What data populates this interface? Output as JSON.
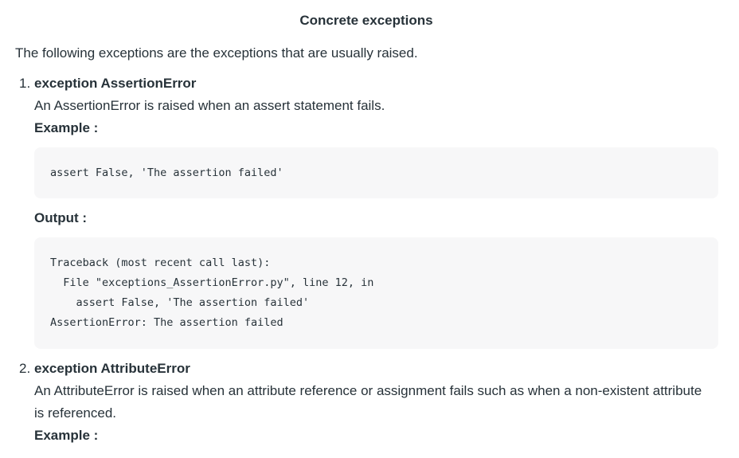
{
  "title": "Concrete exceptions",
  "intro": "The following exceptions are the exceptions that are usually raised.",
  "items": [
    {
      "number": "1.",
      "heading": "exception AssertionError",
      "description": "An AssertionError is raised when an assert statement fails.",
      "example_label": "Example :",
      "example_code": [
        "assert False, 'The assertion failed'"
      ],
      "output_label": "Output :",
      "output_code": [
        "Traceback (most recent call last):",
        "  File \"exceptions_AssertionError.py\", line 12, in",
        "    assert False, 'The assertion failed'",
        "AssertionError: The assertion failed"
      ]
    },
    {
      "number": "2.",
      "heading": "exception AttributeError",
      "description": "An AttributeError is raised when an attribute reference or assignment fails such as when a non-existent attribute is referenced.",
      "example_label": "Example :"
    }
  ]
}
